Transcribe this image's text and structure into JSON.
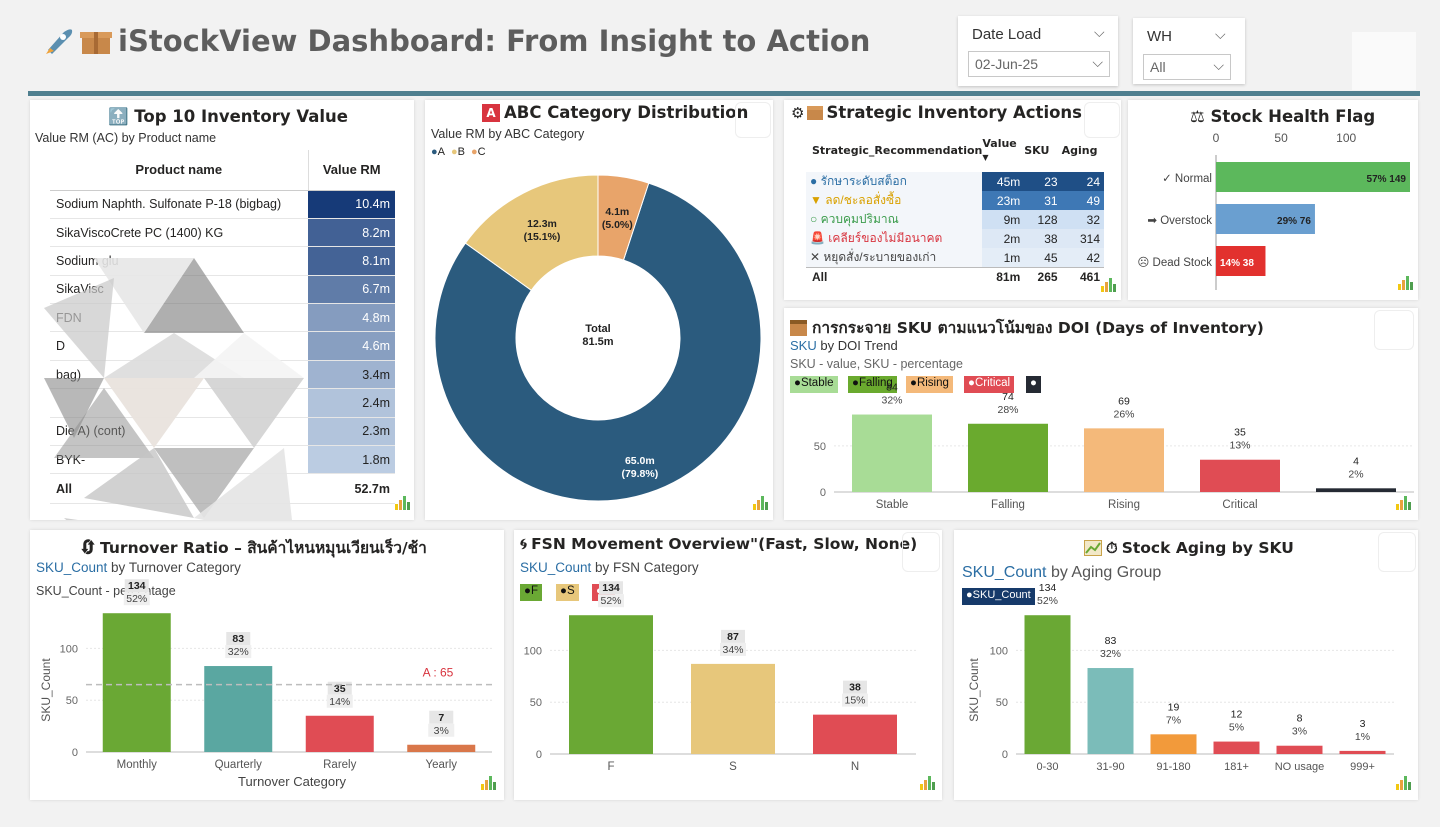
{
  "header": {
    "icons": [
      "rocket-icon",
      "gift-box-icon"
    ],
    "title": "iStockView Dashboard: From Insight to Action"
  },
  "slicers": {
    "date_load": {
      "label": "Date Load",
      "value": "02-Jun-25"
    },
    "wh": {
      "label": "WH",
      "value": "All"
    }
  },
  "top10": {
    "title": "🔝 Top 10 Inventory Value",
    "subtitle": "Value RM (AC) by Product name",
    "columns": [
      "Product name",
      "Value RM"
    ],
    "rows": [
      {
        "name": "Sodium Naphth. Sulfonate P-18 (bigbag)",
        "value": "10.4m",
        "amount": 10.4
      },
      {
        "name": "SikaViscoCrete PC (1400) KG",
        "value": "8.2m",
        "amount": 8.2
      },
      {
        "name": "Sodium glu",
        "value": "8.1m",
        "amount": 8.1
      },
      {
        "name": "SikaVisc",
        "value": "6.7m",
        "amount": 6.7
      },
      {
        "name": "FDN",
        "value": "4.8m",
        "amount": 4.8
      },
      {
        "name": "D",
        "value": "4.6m",
        "amount": 4.6
      },
      {
        "name": "bag)",
        "value": "3.4m",
        "amount": 3.4
      },
      {
        "name": "",
        "value": "2.4m",
        "amount": 2.4
      },
      {
        "name": "Die A) (cont)",
        "value": "2.3m",
        "amount": 2.3
      },
      {
        "name": "BYK-",
        "value": "1.8m",
        "amount": 1.8
      }
    ],
    "total": {
      "label": "All",
      "value": "52.7m"
    }
  },
  "abc": {
    "title": "ABC Category Distribution",
    "badge": "A",
    "subtitle": "Value RM by ABC Category",
    "legend": [
      "A",
      "B",
      "C"
    ],
    "colors": {
      "A": "#2b5b7e",
      "B": "#e7c77b",
      "C": "#e8a46a"
    },
    "center_label": "Total",
    "center_value": "81.5m"
  },
  "strategic": {
    "title": "Strategic Inventory Actions",
    "columns": [
      "Strategic_Recommendation",
      "Value",
      "SKU",
      "Aging"
    ],
    "rows": [
      {
        "label": "● รักษาระดับสต็อก",
        "value": "45m",
        "sku": "23",
        "aging": "24",
        "color": "#2b6ea4"
      },
      {
        "label": "▼ ลด/ชะลอสั่งซื้อ",
        "value": "23m",
        "sku": "31",
        "aging": "49",
        "color": "#d9a100"
      },
      {
        "label": "○ ควบคุมปริมาณ",
        "value": "9m",
        "sku": "128",
        "aging": "32",
        "color": "#3c9c4c"
      },
      {
        "label": "🚨 เคลียร์ของไม่มีอนาคต",
        "value": "2m",
        "sku": "38",
        "aging": "314",
        "color": "#d8343f"
      },
      {
        "label": "✕ หยุดสั่ง/ระบายของเก่า",
        "value": "1m",
        "sku": "45",
        "aging": "42",
        "color": "#444444"
      }
    ],
    "total": {
      "label": "All",
      "value": "81m",
      "sku": "265",
      "aging": "461"
    }
  },
  "health": {
    "title": "⚖ Stock Health Flag",
    "ticks": [
      "0",
      "50",
      "100"
    ],
    "bars": [
      {
        "label": "✓ Normal",
        "pct": "57%",
        "count": 149,
        "value_label": "57% 149",
        "color": "#5cb85c"
      },
      {
        "label": "➡ Overstock",
        "pct": "29%",
        "count": 76,
        "value_label": "29% 76",
        "color": "#6a9fd0"
      },
      {
        "label": "☹ Dead Stock",
        "pct": "14%",
        "count": 38,
        "value_label": "14% 38",
        "color": "#e2312e"
      }
    ]
  },
  "doi": {
    "title": "การกระจาย SKU ตามแนวโน้มของ DOI (Days of Inventory)",
    "subtitle_blue": "SKU",
    "subtitle_rest": "by DOI Trend",
    "subtitle2": "SKU - value, SKU - percentage",
    "legend": [
      {
        "label": "●Stable",
        "color": "#a8dc96"
      },
      {
        "label": "●Falling",
        "color": "#6aaa2e"
      },
      {
        "label": "●Rising",
        "color": "#f4b97a"
      },
      {
        "label": "●Critical",
        "color": "#e04c54"
      },
      {
        "label": "●",
        "color": "#252a33"
      }
    ]
  },
  "turnover": {
    "title": "Turnover Ratio – สินค้าไหนหมุนเวียนเร็ว/ช้า",
    "subtitle_blue": "SKU_Count",
    "subtitle_rest": " by  Turnover Category",
    "subtitle2": "SKU_Count  - percentage",
    "avg_label": "A : 65"
  },
  "fsn": {
    "title": "FSN Movement Overview\"(Fast, Slow, None)",
    "subtitle_blue": "SKU_Count",
    "subtitle_rest": " by  FSN Category",
    "legend": [
      {
        "label": "●F",
        "color": "#6aa834"
      },
      {
        "label": "●S",
        "color": "#e7c77b"
      },
      {
        "label": "●N",
        "color": "#e04c54"
      }
    ]
  },
  "aging": {
    "title": "Stock Aging by SKU",
    "subtitle_blue": "SKU_Count",
    "subtitle_rest": " by Aging Group",
    "legend": "●SKU_Count"
  },
  "chart_data": [
    {
      "type": "pie",
      "title": "ABC Category Distribution",
      "subtitle": "Value RM by ABC Category",
      "categories": [
        "A",
        "B",
        "C"
      ],
      "values": [
        65.0,
        12.3,
        4.1
      ],
      "labels": [
        "65.0m (79.8%)",
        "12.3m (15.1%)",
        "4.1m (5.0%)"
      ]
    },
    {
      "type": "bar",
      "title": "Stock Health Flag",
      "categories": [
        "Normal",
        "Overstock",
        "Dead Stock"
      ],
      "values": [
        149,
        76,
        38
      ],
      "percentages": [
        "57%",
        "29%",
        "14%"
      ],
      "xlim": [
        0,
        149
      ]
    },
    {
      "type": "bar",
      "title": "การกระจาย SKU ตามแนวโน้มของ DOI (Days of Inventory)",
      "categories": [
        "Stable",
        "Falling",
        "Rising",
        "Critical",
        ""
      ],
      "values": [
        84,
        74,
        69,
        35,
        4
      ],
      "percentages": [
        "32%",
        "28%",
        "26%",
        "13%",
        "2%"
      ],
      "colors": [
        "#a8dc96",
        "#6aaa2e",
        "#f4b97a",
        "#e04c54",
        "#252a33"
      ],
      "yticks": [
        0,
        50
      ],
      "ylim": [
        0,
        90
      ]
    },
    {
      "type": "bar",
      "title": "Turnover Ratio – สินค้าไหนหมุนเวียนเร็ว/ช้า",
      "categories": [
        "Monthly",
        "Quarterly",
        "Rarely",
        "Yearly"
      ],
      "values": [
        134,
        83,
        35,
        7
      ],
      "percentages": [
        "52%",
        "32%",
        "14%",
        "3%"
      ],
      "colors": [
        "#6aa834",
        "#5aa7a1",
        "#e04c54",
        "#d9774a"
      ],
      "xlabel": "Turnover Category",
      "ylabel": "SKU_Count",
      "yticks": [
        0,
        50,
        100
      ],
      "ylim": [
        0,
        140
      ],
      "reference_line": 65
    },
    {
      "type": "bar",
      "title": "FSN Movement Overview\"(Fast, Slow, None)",
      "categories": [
        "F",
        "S",
        "N"
      ],
      "values": [
        134,
        87,
        38
      ],
      "percentages": [
        "52%",
        "34%",
        "15%"
      ],
      "colors": [
        "#6aa834",
        "#e7c77b",
        "#e04c54"
      ],
      "yticks": [
        0,
        50,
        100
      ],
      "ylim": [
        0,
        140
      ]
    },
    {
      "type": "bar",
      "title": "Stock Aging by SKU",
      "categories": [
        "0-30",
        "31-90",
        "91-180",
        "181+",
        "NO usage",
        "999+"
      ],
      "values": [
        134,
        83,
        19,
        12,
        8,
        3
      ],
      "percentages": [
        "52%",
        "32%",
        "7%",
        "5%",
        "3%",
        "1%"
      ],
      "colors": [
        "#6aa834",
        "#7bbcb9",
        "#f29a3b",
        "#e04c54",
        "#e04c54",
        "#e04c54"
      ],
      "ylabel": "SKU_Count",
      "yticks": [
        0,
        50,
        100
      ],
      "ylim": [
        0,
        140
      ]
    }
  ]
}
